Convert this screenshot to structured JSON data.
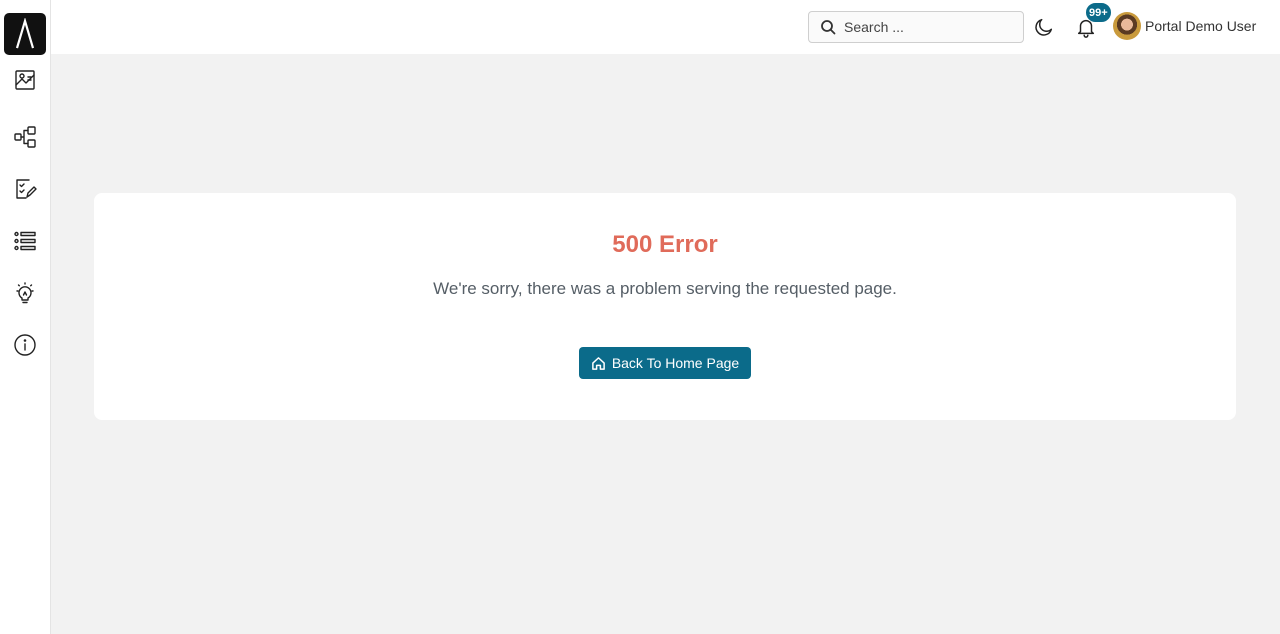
{
  "header": {
    "search": {
      "placeholder": "Search ...",
      "value": ""
    },
    "notifications": {
      "badge": "99+"
    },
    "user": {
      "name": "Portal Demo User"
    }
  },
  "sidebar": {
    "logo": "logo-icon",
    "items": [
      {
        "icon": "analytics-icon"
      },
      {
        "icon": "workflow-icon"
      },
      {
        "icon": "task-edit-icon"
      },
      {
        "icon": "list-icon"
      },
      {
        "icon": "lightbulb-icon"
      },
      {
        "icon": "info-icon"
      }
    ]
  },
  "error": {
    "title": "500 Error",
    "message": "We're sorry, there was a problem serving the requested page.",
    "button_label": "Back To Home Page"
  },
  "colors": {
    "accent": "#0b6b8a",
    "error_title": "#e06b5a",
    "background": "#f2f2f2"
  }
}
